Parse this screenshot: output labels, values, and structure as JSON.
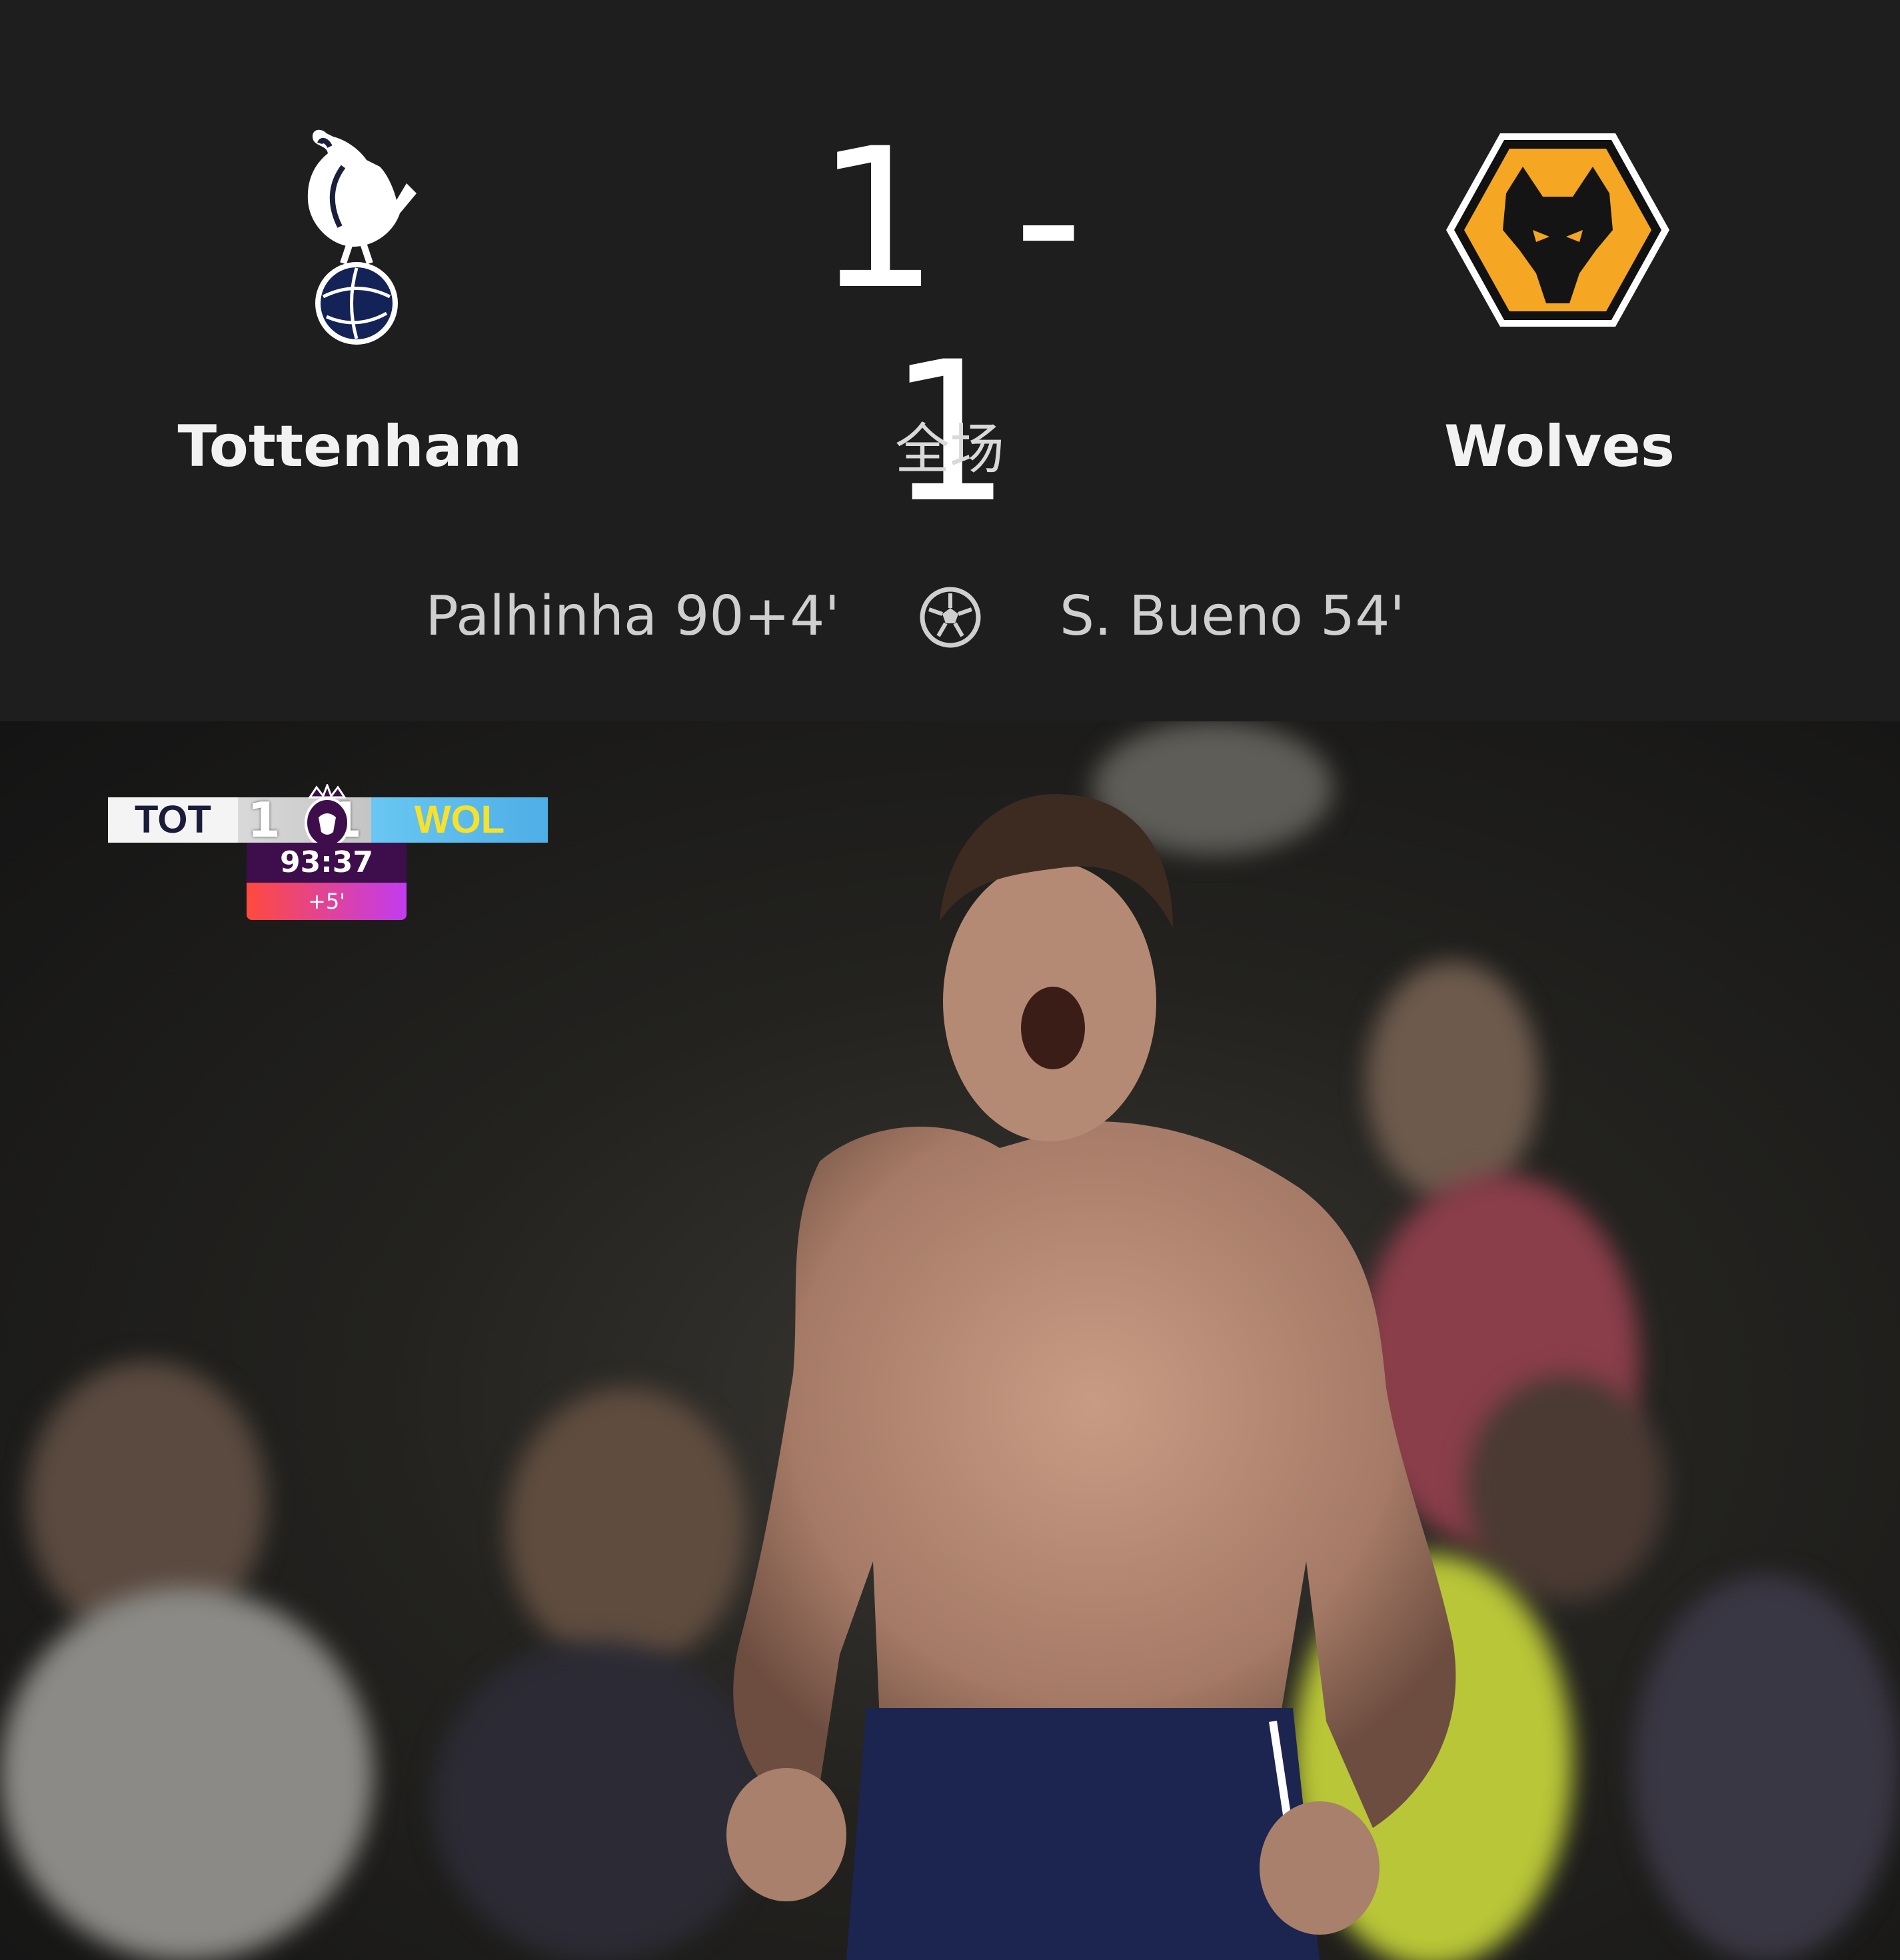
{
  "match": {
    "home_team": "Tottenham",
    "away_team": "Wolves",
    "home_score": "1",
    "away_score": "1",
    "score_display": "1 - 1",
    "status": "全场",
    "home_scorer": "Palhinha 90+4'",
    "away_scorer": "S.  Bueno 54'"
  },
  "icons": {
    "home_crest": "tottenham-cockerel-crest",
    "away_crest": "wolves-wolf-head-crest",
    "goal": "soccer-ball-icon"
  },
  "scorebug": {
    "home_abbr": "TOT",
    "home_goals": "1",
    "away_goals": "1",
    "away_abbr": "WOL",
    "clock": "93:37",
    "added_time": "+5'"
  },
  "colors": {
    "background": "#1e1e1e",
    "wolves_gold": "#f5a623",
    "spurs_navy": "#132257",
    "bug_clock": "#3d0e4b"
  }
}
